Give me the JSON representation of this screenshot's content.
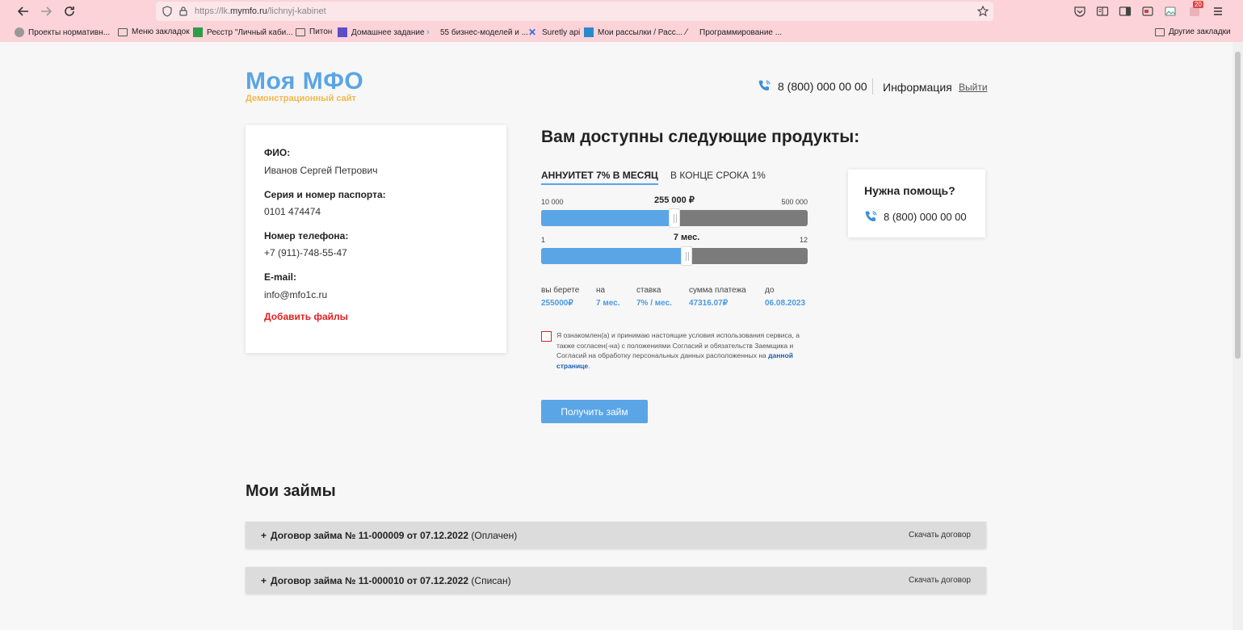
{
  "browser": {
    "url_prefix": "https://lk.",
    "url_domain": "mymfo.ru",
    "url_path": "/lichnyj-kabinet",
    "badge_count": "20",
    "bookmarks": [
      "Проекты нормативн...",
      "Меню закладок",
      "Реєстр \"Личный каби...",
      "Питон",
      "Домашнее задание",
      "55 бизнес-моделей и ...",
      "Suretly api",
      "Мои рассылки / Расс...",
      "Программирование ..."
    ],
    "other_bookmarks": "Другие закладки"
  },
  "header": {
    "logo_title": "Моя МФО",
    "logo_subtitle": "Демонстрационный сайт",
    "phone": "8 (800) 000 00 00",
    "info": "Информация",
    "logout": "Выйти"
  },
  "profile": {
    "fio_label": "ФИО:",
    "fio_value": "Иванов Сергей Петрович",
    "passport_label": "Серия и номер паспорта:",
    "passport_value": "0101 474474",
    "phone_label": "Номер телефона:",
    "phone_value": "+7 (911)-748-55-47",
    "email_label": "E-mail:",
    "email_value": "info@mfo1c.ru",
    "add_files": "Добавить файлы"
  },
  "products": {
    "title": "Вам доступны следующие продукты:",
    "tabs": [
      "АННУИТЕТ 7% В МЕСЯЦ",
      "В КОНЦЕ СРОКА 1%"
    ],
    "amount": {
      "min": "10 000",
      "max": "500 000",
      "current": "255 000 ₽",
      "fraction": 0.5
    },
    "term": {
      "min": "1",
      "max": "12",
      "current": "7 мес.",
      "fraction": 0.545
    },
    "summary": [
      {
        "label": "вы берете",
        "value": "255000₽"
      },
      {
        "label": "на",
        "value": "7 мес."
      },
      {
        "label": "ставка",
        "value": "7% / мес."
      },
      {
        "label": "сумма платежа",
        "value": "47316.07₽"
      },
      {
        "label": "до",
        "value": "06.08.2023"
      }
    ],
    "agreement_text": "Я ознакомлен(а) и принимаю настоящие условия использования сервиса, а также согласен(-на) с положениями Согласий и обязательств Заемщика и Согласий на обработку персональных данных расположенных на ",
    "agreement_link": "данной странице",
    "agreement_end": ".",
    "submit": "Получить займ"
  },
  "help": {
    "title": "Нужна помощь?",
    "phone": "8 (800) 000 00 00"
  },
  "loans": {
    "title": "Мои займы",
    "items": [
      {
        "name": "Договор займа № 11-000009 от 07.12.2022",
        "status": "(Оплачен)",
        "download": "Скачать договор"
      },
      {
        "name": "Договор займа № 11-000010 от 07.12.2022",
        "status": "(Списан)",
        "download": "Скачать договор"
      }
    ]
  },
  "colors": {
    "accent": "#5aa5e6",
    "logo_sub": "#f2b84b",
    "error": "#e02020",
    "chrome": "#fbd3d9"
  }
}
